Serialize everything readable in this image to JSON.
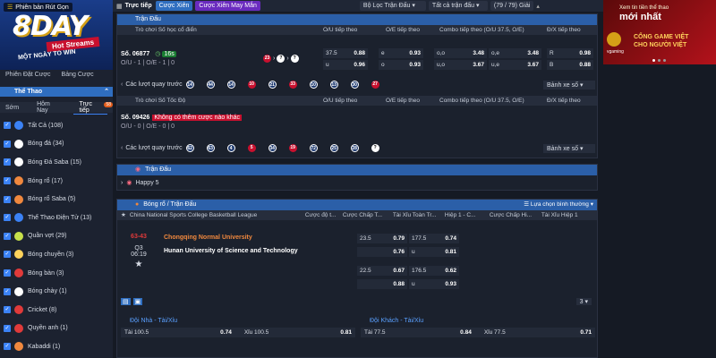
{
  "brand": {
    "name": "8DAY",
    "hot": "Hot Streams",
    "tagline": "MỘT NGÀY TO WIN",
    "btn_top": "Phiên bản Rút Gọn"
  },
  "sidebar": {
    "tabs": [
      "Phiên Đặt Cược",
      "Bảng Cược"
    ],
    "sport_header": "Thể Thao",
    "time_tabs": [
      "Sớm",
      "Hôm Nay",
      "Trực tiếp"
    ],
    "live_badge": "58",
    "items": [
      {
        "label": "Tất Cả",
        "count": "(108)"
      },
      {
        "label": "Bóng đá",
        "count": "(34)"
      },
      {
        "label": "Bóng Đá Saba",
        "count": "(15)"
      },
      {
        "label": "Bóng rổ",
        "count": "(17)"
      },
      {
        "label": "Bóng rổ Saba",
        "count": "(5)"
      },
      {
        "label": "Thể Thao Điện Tử",
        "count": "(13)"
      },
      {
        "label": "Quần vợt",
        "count": "(29)"
      },
      {
        "label": "Bóng chuyền",
        "count": "(3)"
      },
      {
        "label": "Bóng bàn",
        "count": "(3)"
      },
      {
        "label": "Bóng chày",
        "count": "(1)"
      },
      {
        "label": "Cricket",
        "count": "(8)"
      },
      {
        "label": "Quyền anh",
        "count": "(1)"
      },
      {
        "label": "Kabaddi",
        "count": "(1)"
      }
    ]
  },
  "topbar": {
    "live": "Trực tiếp",
    "xien": "Cược Xiên",
    "xien_lucky": "Cược Xiên May Mắn",
    "filter": "Bộ Lọc Trận Đấu",
    "all_odds": "Tất cả trận đấu",
    "count": "(79 / 79)",
    "sort": "Giải"
  },
  "section1": {
    "title": "Trận Đấu",
    "game1": {
      "name": "Trò chơi Số học cổ điển",
      "cols": [
        "O/U tiếp theo",
        "O/E tiếp theo",
        "Combo tiếp theo (O/U 37.5, O/E)",
        "Đ/X tiếp theo"
      ],
      "id": "Số. 06877",
      "timer": "16s",
      "score1": "O/U - 1 | O/E - 1 | 0",
      "balls_cur": [
        "23",
        "?",
        "?"
      ],
      "ou": [
        {
          "k": "37.5",
          "v": "0.88"
        },
        {
          "k": "u",
          "v": "0.96"
        }
      ],
      "oe": [
        {
          "k": "e",
          "v": "0.93"
        },
        {
          "k": "o",
          "v": "0.93"
        }
      ],
      "combo": [
        {
          "k": "o,o",
          "v": "3.48"
        },
        {
          "k": "u,o",
          "v": "3.67"
        },
        {
          "k": "o,e",
          "v": "3.48"
        },
        {
          "k": "u,e",
          "v": "3.67"
        }
      ],
      "dx": [
        {
          "k": "R",
          "v": "0.98"
        },
        {
          "k": "B",
          "v": "0.88"
        }
      ],
      "recent_label": "Các lượt quay trước",
      "recent": [
        "14",
        "44",
        "14",
        "10",
        "21",
        "33",
        "10",
        "13",
        "30",
        "27"
      ],
      "filter": "Bảnh xe số"
    },
    "game2": {
      "name": "Trò chơi Số Tốc Độ",
      "cols": [
        "O/U tiếp theo",
        "O/E tiếp theo",
        "Combo tiếp theo (O/U 37.5, O/E)",
        "Đ/X tiếp theo"
      ],
      "id": "Số. 09426",
      "note": "Không có thêm cược nào khác",
      "score": "O/U - 0 | O/E - 0 | 0",
      "recent_label": "Các lượt quay trước",
      "recent": [
        "62",
        "63",
        "4",
        "5",
        "34",
        "19",
        "72",
        "25",
        "28",
        "?"
      ],
      "filter": "Bảnh xe số"
    }
  },
  "section2": {
    "title": "Trận Đấu",
    "league": "Happy 5"
  },
  "section3": {
    "title": "Bóng rổ / Trận Đấu",
    "tools": "Lựa chọn bình thường",
    "league": "China National Sports College Basketball League",
    "cols": [
      "Cược độ t...",
      "Cược Chấp T...",
      "Tài Xỉu Toàn Tr...",
      "Hiệp 1 - C...",
      "Cược Chấp Hi...",
      "Tài Xỉu Hiệp 1"
    ],
    "score": "63-43",
    "quarter": "Q3",
    "clock": "06:19",
    "home": "Chongqing Normal University",
    "away": "Hunan University of Science and Technology",
    "row1": {
      "hcap": "23.5",
      "h1": "0.79",
      "ou": "177.5",
      "o1": "0.74",
      "h2": "0.76",
      "o2": "u",
      "o2v": "0.81"
    },
    "row2": {
      "hcap": "22.5",
      "h1": "0.67",
      "ou": "176.5",
      "o1": "0.62",
      "h2": "0.88",
      "o2": "u",
      "o2v": "0.93"
    },
    "more": "3",
    "home_ou": {
      "title": "Đội Nhà - Tài/Xỉu",
      "tai": "Tài",
      "tai_v": "100.5",
      "tai_o": "0.74",
      "xiu": "Xỉu",
      "xiu_v": "100.5",
      "xiu_o": "0.81"
    },
    "away_ou": {
      "title": "Đội Khách - Tài/Xỉu",
      "tai": "Tài",
      "tai_v": "77.5",
      "tai_o": "0.84",
      "xiu": "Xỉu",
      "xiu_v": "77.5",
      "xiu_o": "0.71"
    }
  },
  "ad": {
    "line1": "Xem tin tiền thể thao",
    "line2": "mới nhất",
    "brand": "vgaming",
    "slogan1": "CỔNG GAME VIỆT",
    "slogan2": "CHO NGƯỜI VIỆT"
  }
}
